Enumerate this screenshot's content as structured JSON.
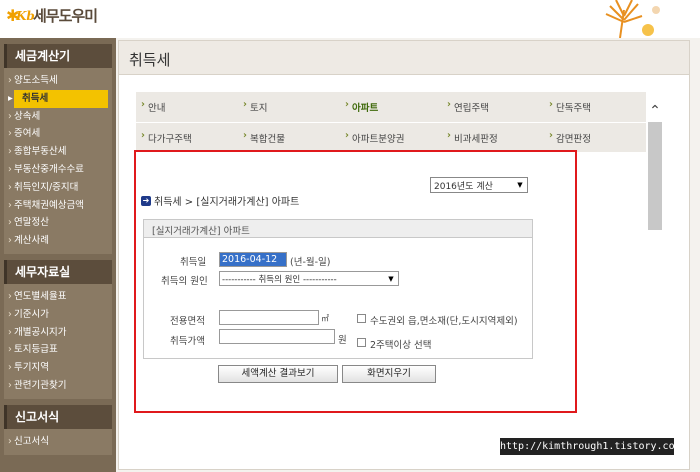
{
  "brand": {
    "name": "세무도우미"
  },
  "sidebar": {
    "sections": [
      {
        "title": "세금계산기",
        "items": [
          "양도소득세",
          "취득세",
          "상속세",
          "증여세",
          "종합부동산세",
          "부동산중개수수료",
          "취득인지/증지대",
          "주택채권예상금액",
          "연말정산",
          "계산사례"
        ],
        "active_index": 1
      },
      {
        "title": "세무자료실",
        "items": [
          "연도별세율표",
          "기준시가",
          "개별공시지가",
          "토지등급표",
          "투기지역",
          "관련기관찾기"
        ]
      },
      {
        "title": "신고서식",
        "items": [
          "신고서식"
        ]
      }
    ]
  },
  "main": {
    "title": "취득세"
  },
  "tabs": {
    "row1": [
      "안내",
      "토지",
      "아파트",
      "연립주택",
      "단독주택"
    ],
    "row2": [
      "다가구주택",
      "복합건물",
      "아파트분양권",
      "비과세판정",
      "감면판정"
    ],
    "active": "아파트"
  },
  "calc": {
    "year_select": "2016년도 계산",
    "breadcrumb": "취득세 > [실지거래가계산] 아파트",
    "form_title": "[실지거래가계산] 아파트",
    "acq_date_label": "취득일",
    "acq_date_value": "2016-04-12",
    "acq_date_hint": "(년-월-일)",
    "cause_label": "취득의 원인",
    "cause_value": "----------- 취득의 원인 -----------",
    "area_label": "전용면적",
    "area_unit": "㎡",
    "price_label": "취득가액",
    "price_unit": "원",
    "check1_label": "수도권외 읍,면소재(단,도시지역제외)",
    "check2_label": "2주택이상 선택",
    "btn_result": "세액계산 결과보기",
    "btn_clear": "화면지우기"
  },
  "watermark": "http://kimthrough1.tistory.com",
  "colors": {
    "sidebar": "#7a6a55",
    "active_item": "#f3c200",
    "highlight_border": "#e0191c",
    "active_tab": "#3f6a0a"
  }
}
